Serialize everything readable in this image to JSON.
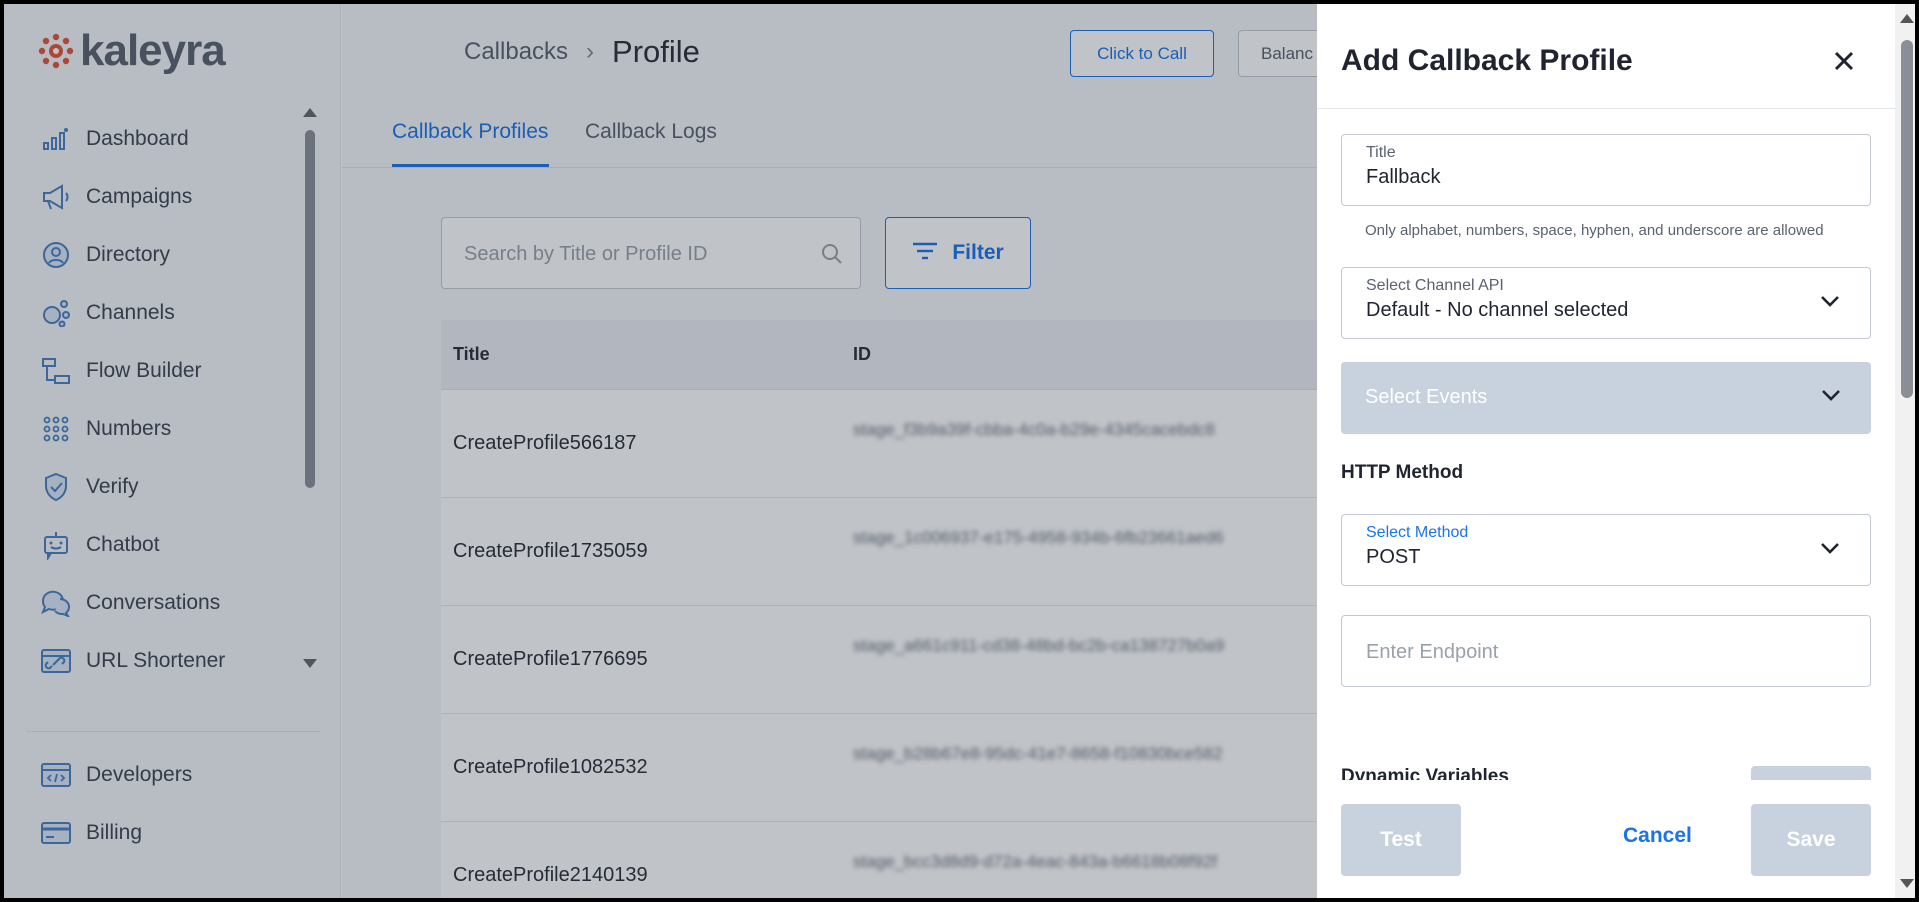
{
  "brand": {
    "name": "kaleyra"
  },
  "sidebar": {
    "items": [
      {
        "label": "Dashboard",
        "icon": "bar-chart-icon"
      },
      {
        "label": "Campaigns",
        "icon": "megaphone-icon"
      },
      {
        "label": "Directory",
        "icon": "user-circle-icon"
      },
      {
        "label": "Channels",
        "icon": "channels-icon"
      },
      {
        "label": "Flow Builder",
        "icon": "flow-icon"
      },
      {
        "label": "Numbers",
        "icon": "dial-grid-icon"
      },
      {
        "label": "Verify",
        "icon": "shield-check-icon"
      },
      {
        "label": "Chatbot",
        "icon": "bot-icon"
      },
      {
        "label": "Conversations",
        "icon": "chat-bubbles-icon"
      },
      {
        "label": "URL Shortener",
        "icon": "link-icon"
      }
    ],
    "bottom_items": [
      {
        "label": "Developers",
        "icon": "code-window-icon"
      },
      {
        "label": "Billing",
        "icon": "card-icon"
      }
    ]
  },
  "header": {
    "breadcrumb_parent": "Callbacks",
    "breadcrumb_sep": "›",
    "page_title": "Profile",
    "click_to_call": "Click to Call",
    "balance": "Balanc"
  },
  "tabs": [
    {
      "label": "Callback Profiles",
      "active": true
    },
    {
      "label": "Callback Logs",
      "active": false
    }
  ],
  "search": {
    "placeholder": "Search by Title or Profile ID"
  },
  "filter": {
    "label": "Filter"
  },
  "table": {
    "columns": [
      "Title",
      "ID"
    ],
    "rows": [
      {
        "title": "CreateProfile566187",
        "id": "stage_f3b9a39f-cbba-4c0a-b29e-4345cacebdc8"
      },
      {
        "title": "CreateProfile1735059",
        "id": "stage_1c006937-e175-4958-934b-6fb23661aed6"
      },
      {
        "title": "CreateProfile1776695",
        "id": "stage_a661c911-cd38-48bd-bc2b-ca138727b0a9"
      },
      {
        "title": "CreateProfile1082532",
        "id": "stage_b28b67e8-95dc-41e7-8658-f10830bce582"
      },
      {
        "title": "CreateProfile2140139",
        "id": "stage_bcc3d8d9-d72a-4eac-843a-b6618b08f92f"
      }
    ]
  },
  "drawer": {
    "title": "Add Callback Profile",
    "title_field": {
      "label": "Title",
      "value": "Fallback"
    },
    "title_help": "Only alphabet, numbers, space, hyphen, and underscore are allowed",
    "channel_field": {
      "label": "Select Channel API",
      "value": "Default - No channel selected"
    },
    "events_field": {
      "label": "Select Events"
    },
    "http_method_heading": "HTTP Method",
    "method_field": {
      "label": "Select Method",
      "value": "POST"
    },
    "endpoint": {
      "placeholder": "Enter Endpoint"
    },
    "dynamic_variables": "Dynamic Variables",
    "test_button": "Test",
    "cancel_button": "Cancel",
    "save_button": "Save"
  },
  "colors": {
    "accent": "#1a73e8",
    "disabled": "#c8d2de",
    "sidebar_icon": "#4a7fc1"
  }
}
